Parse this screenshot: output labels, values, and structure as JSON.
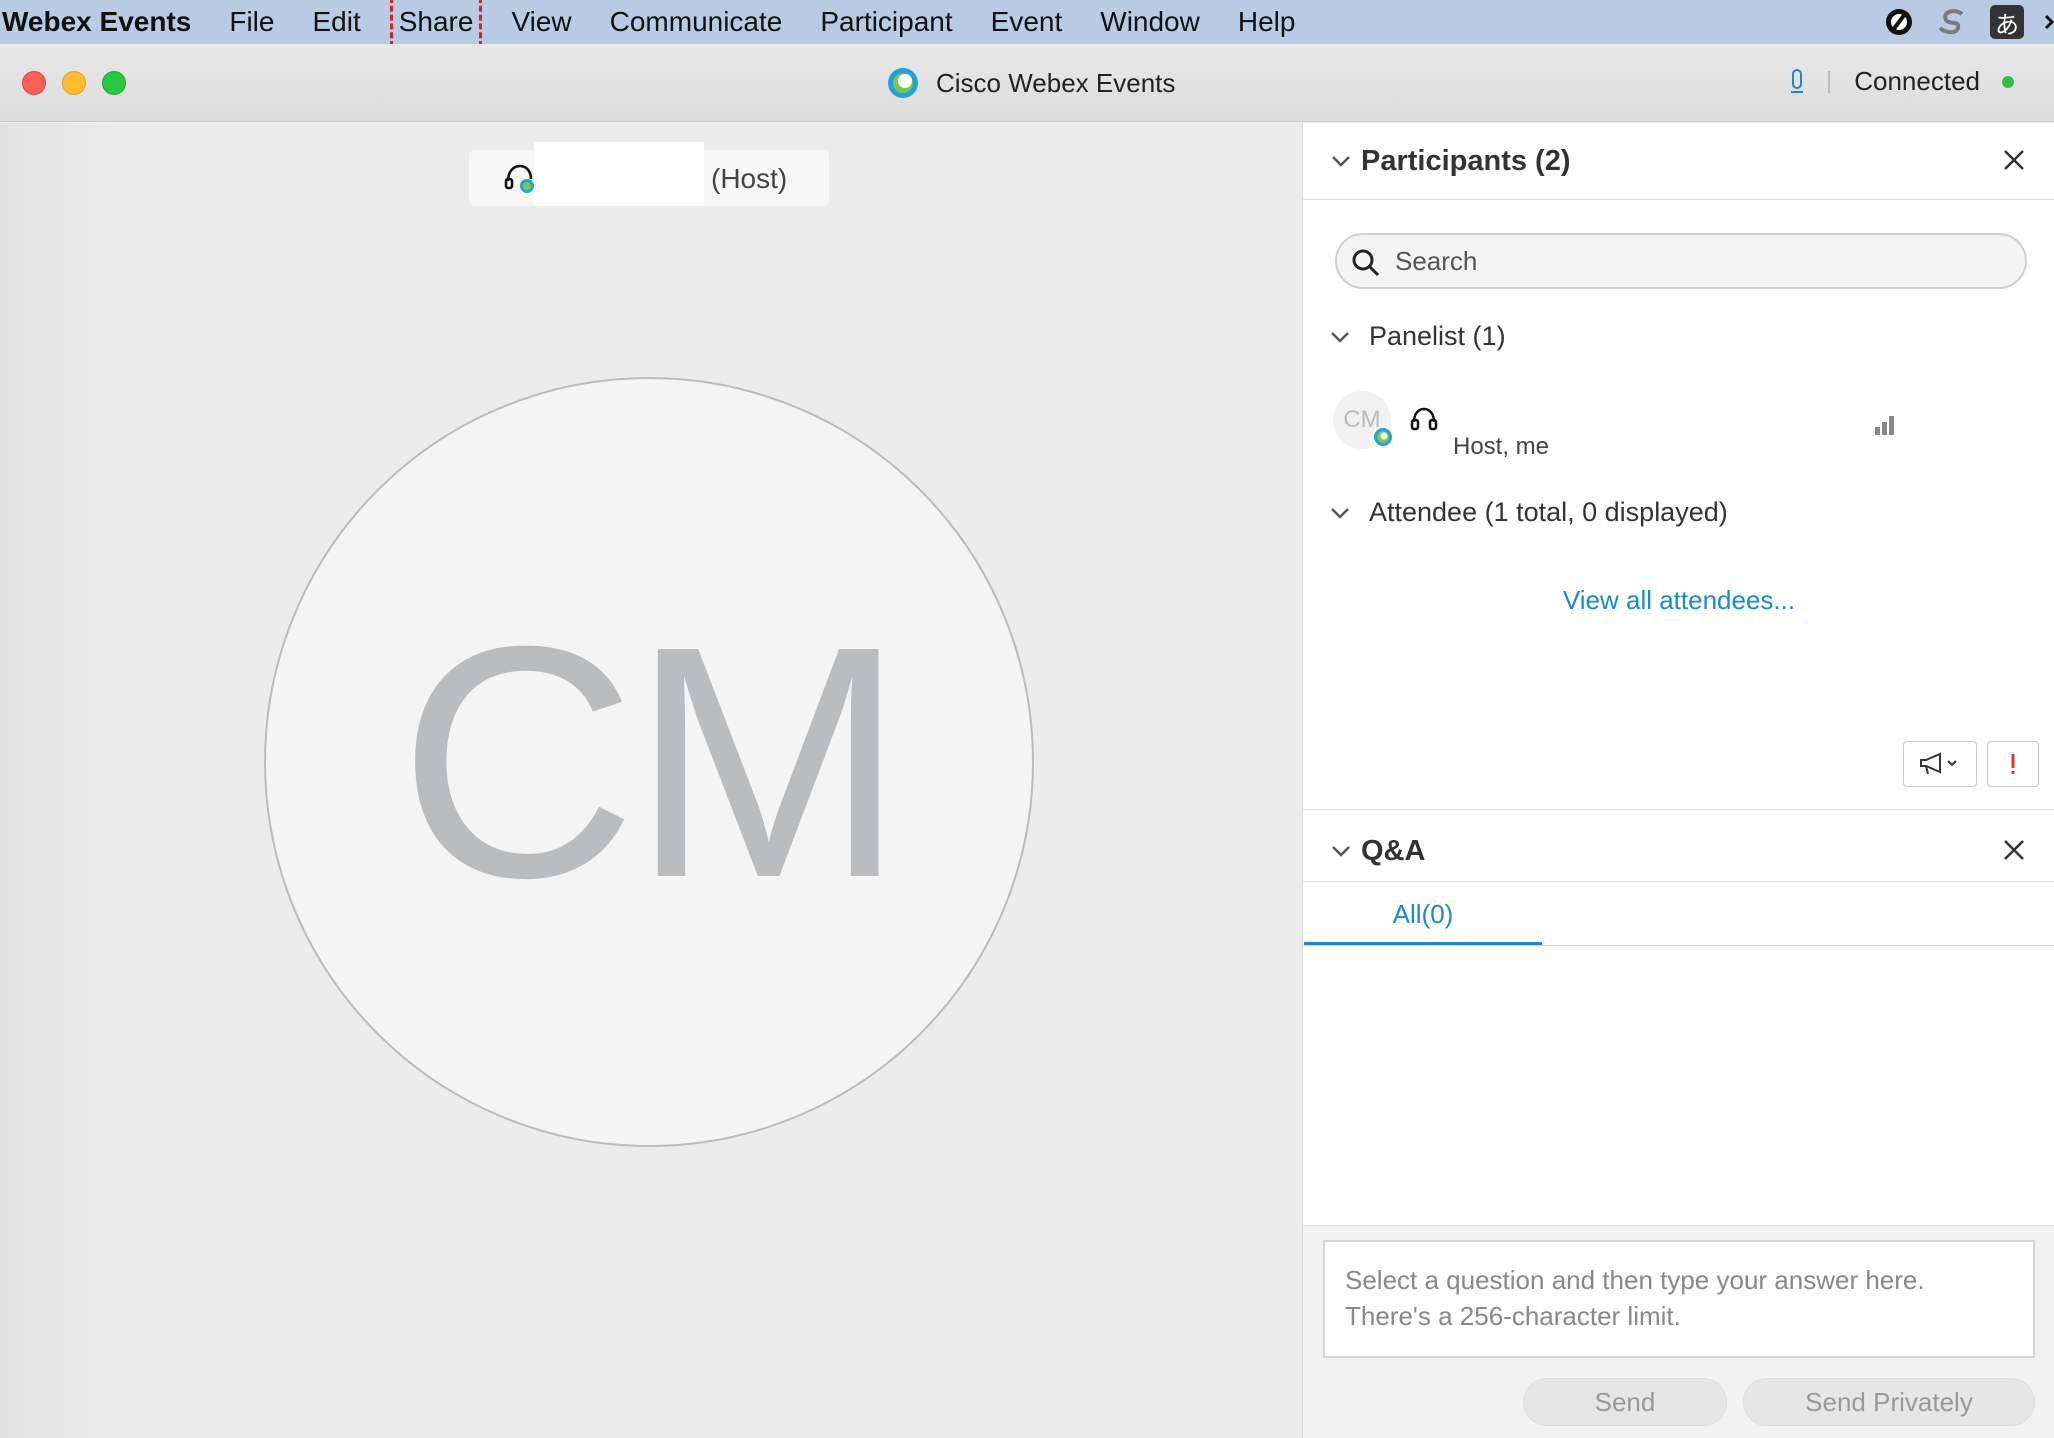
{
  "menubar": {
    "app_name": "Webex Events",
    "items": [
      "File",
      "Edit",
      "Share",
      "View",
      "Communicate",
      "Participant",
      "Event",
      "Window",
      "Help"
    ],
    "highlighted_item": "Share",
    "tray_icons": [
      "proxy-icon",
      "s-icon",
      "input-method-icon"
    ],
    "input_method_glyph": "あ"
  },
  "window": {
    "title": "Cisco Webex Events",
    "status": "Connected",
    "status_color": "#2fbf4a"
  },
  "stage": {
    "presenter_role": "(Host)",
    "avatar_initials": "CM"
  },
  "participants": {
    "title": "Participants (2)",
    "search_placeholder": "Search",
    "panelist_group": "Panelist (1)",
    "panelist": {
      "initials": "CM",
      "role": "Host, me"
    },
    "attendee_group": "Attendee (1 total, 0 displayed)",
    "view_all_link": "View all attendees..."
  },
  "qa": {
    "title": "Q&A",
    "tab_all": "All(0)",
    "answer_placeholder": "Select a question and then type your answer here. There's a 256-character limit.",
    "send_label": "Send",
    "send_privately_label": "Send Privately"
  },
  "colors": {
    "accent": "#1a8bc9",
    "menubar": "#b9cbe3",
    "highlight": "#e02020"
  }
}
